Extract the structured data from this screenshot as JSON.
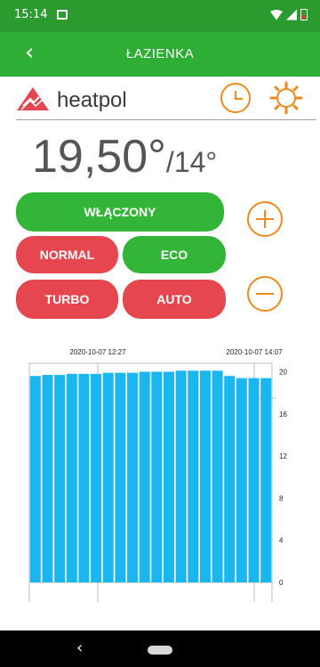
{
  "status_bar": {
    "time": "15:14",
    "battery_color": "#e23a3a"
  },
  "header": {
    "title": "ŁAZIENKA",
    "back_icon": "chevron-left-icon",
    "background": "#2eae34"
  },
  "brand": {
    "name": "heatpol",
    "logo_color": "#e6474f"
  },
  "temperature": {
    "current": "19,50°",
    "setpoint": "/14°"
  },
  "controls": {
    "on_label": "WŁĄCZONY",
    "normal_label": "NORMAL",
    "eco_label": "ECO",
    "turbo_label": "TURBO",
    "auto_label": "AUTO",
    "accent_color": "#f08a1c",
    "green": "#33b538",
    "red": "#e6474f"
  },
  "chart_data": {
    "type": "bar",
    "x_tick_labels": [
      "2020-10-07 12:27",
      "2020-10-07 14:07"
    ],
    "values": [
      19.6,
      19.7,
      19.7,
      19.8,
      19.8,
      19.8,
      19.9,
      19.9,
      19.9,
      20.0,
      20.0,
      20.0,
      20.1,
      20.1,
      20.1,
      20.1,
      19.6,
      19.4,
      19.4,
      19.4
    ],
    "y_ticks": [
      "20",
      "16",
      "12",
      "8",
      "4",
      "0"
    ],
    "y_tick_values": [
      20,
      16,
      12,
      8,
      4,
      0
    ],
    "ylim": [
      0,
      20
    ],
    "bar_color": "#1ab6f0",
    "grid": true
  }
}
